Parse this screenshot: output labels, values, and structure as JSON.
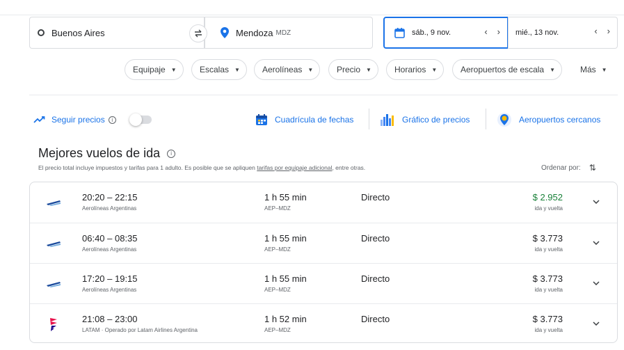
{
  "search": {
    "origin": "Buenos Aires",
    "destination": "Mendoza",
    "destination_code": "MDZ",
    "depart_date": "sáb., 9 nov.",
    "return_date": "mié., 13 nov."
  },
  "filters": [
    {
      "label": "Equipaje"
    },
    {
      "label": "Escalas"
    },
    {
      "label": "Aerolíneas"
    },
    {
      "label": "Precio"
    },
    {
      "label": "Horarios"
    },
    {
      "label": "Aeropuertos de escala"
    },
    {
      "label": "Más"
    }
  ],
  "tools": {
    "track": "Seguir precios",
    "date_grid": "Cuadrícula de fechas",
    "price_graph": "Gráfico de precios",
    "nearby": "Aeropuertos cercanos"
  },
  "results": {
    "title": "Mejores vuelos de ida",
    "note_prefix": "El precio total incluye impuestos y tarifas para 1 adulto. Es posible que se apliquen ",
    "note_link": "tarifas por equipaje adicional",
    "note_suffix": ", entre otras.",
    "sort_label": "Ordenar por:"
  },
  "flights": [
    {
      "times": "20:20 – 22:15",
      "airline": "Aerolíneas Argentinas",
      "duration": "1 h 55 min",
      "route": "AEP–MDZ",
      "stops": "Directo",
      "price": "$ 2.952",
      "price_type": "ida y vuelta",
      "logo": "aerolineas-argentinas-logo",
      "highlight": true
    },
    {
      "times": "06:40 – 08:35",
      "airline": "Aerolíneas Argentinas",
      "duration": "1 h 55 min",
      "route": "AEP–MDZ",
      "stops": "Directo",
      "price": "$ 3.773",
      "price_type": "ida y vuelta",
      "logo": "aerolineas-argentinas-logo",
      "highlight": false
    },
    {
      "times": "17:20 – 19:15",
      "airline": "Aerolíneas Argentinas",
      "duration": "1 h 55 min",
      "route": "AEP–MDZ",
      "stops": "Directo",
      "price": "$ 3.773",
      "price_type": "ida y vuelta",
      "logo": "aerolineas-argentinas-logo",
      "highlight": false
    },
    {
      "times": "21:08 – 23:00",
      "airline": "LATAM · Operado por Latam Airlines Argentina",
      "duration": "1 h 52 min",
      "route": "AEP–MDZ",
      "stops": "Directo",
      "price": "$ 3.773",
      "price_type": "ida y vuelta",
      "logo": "latam-logo",
      "highlight": false
    }
  ],
  "colors": {
    "accent": "#1a73e8",
    "best_price": "#188038",
    "aerolineas": "#1a4a9c",
    "latam_top": "#e8114b",
    "latam_bottom": "#1b0088"
  }
}
